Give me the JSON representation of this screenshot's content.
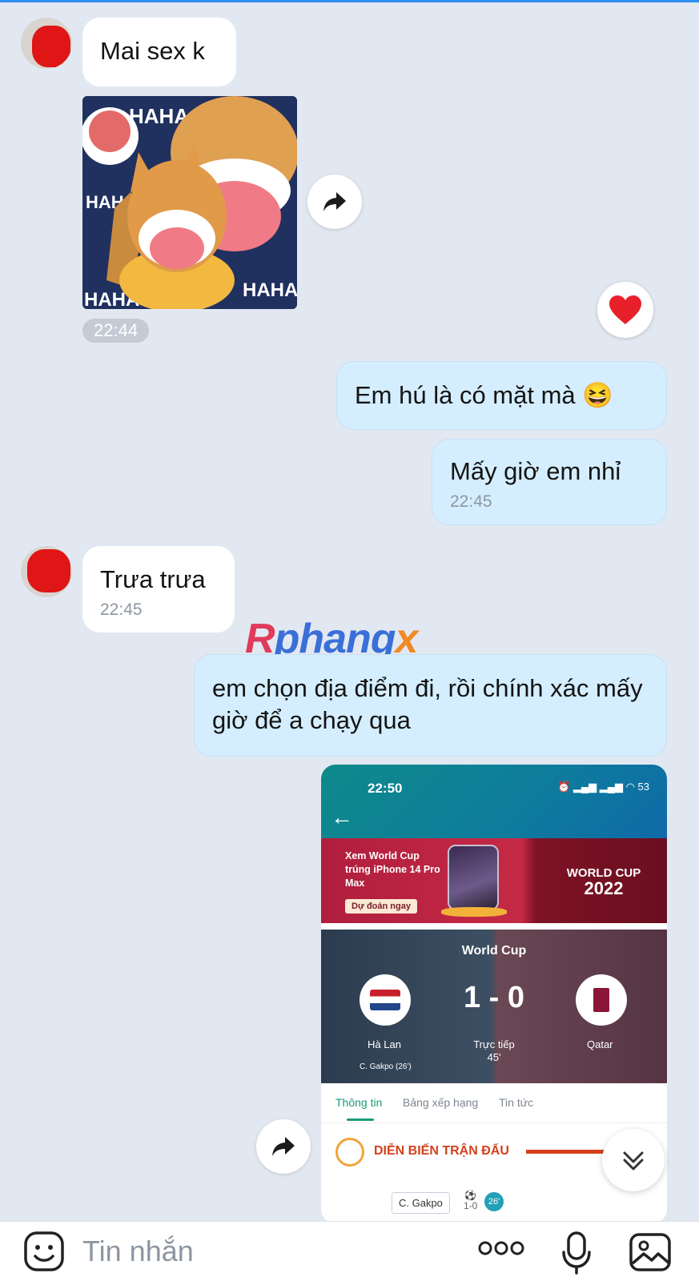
{
  "messages": {
    "m1": {
      "text": "Mai sex k"
    },
    "m2": {
      "sticker_text": "HAHA",
      "time": "22:44",
      "reaction": "heart"
    },
    "m3": {
      "text": "Em hú là có mặt mà 😆"
    },
    "m4": {
      "text": "Mấy giờ em nhỉ",
      "time": "22:45"
    },
    "m5": {
      "text": "Trưa trưa",
      "time": "22:45"
    },
    "m6": {
      "text": "em chọn địa điểm đi, rồi chính xác mấy giờ để a chạy qua"
    }
  },
  "watermark": {
    "part1": "R",
    "part2": "phang",
    "part3": "x"
  },
  "screenshot": {
    "status_time": "22:50",
    "battery": "53",
    "banner": {
      "promo": "Xem World Cup trúng iPhone 14 Pro Max",
      "cta": "Dự đoán ngay",
      "event_line1": "WORLD CUP",
      "event_line2": "2022"
    },
    "match": {
      "competition": "World Cup",
      "score": "1 - 0",
      "home": "Hà Lan",
      "away": "Qatar",
      "status": "Trực tiếp",
      "minute": "45'",
      "scorer": "C. Gakpo (26')"
    },
    "tabs": [
      "Thông tin",
      "Bảng xếp hạng",
      "Tin tức"
    ],
    "section_title": "DIỄN BIẾN TRẬN ĐẤU",
    "event": {
      "player": "C. Gakpo",
      "score": "1-0",
      "minute": "26'"
    }
  },
  "composer": {
    "placeholder": "Tin nhắn"
  },
  "icons": [
    "sticker-icon",
    "forward-icon",
    "heart-icon",
    "more-icon",
    "mic-icon",
    "image-icon",
    "chevron-down-icon"
  ]
}
